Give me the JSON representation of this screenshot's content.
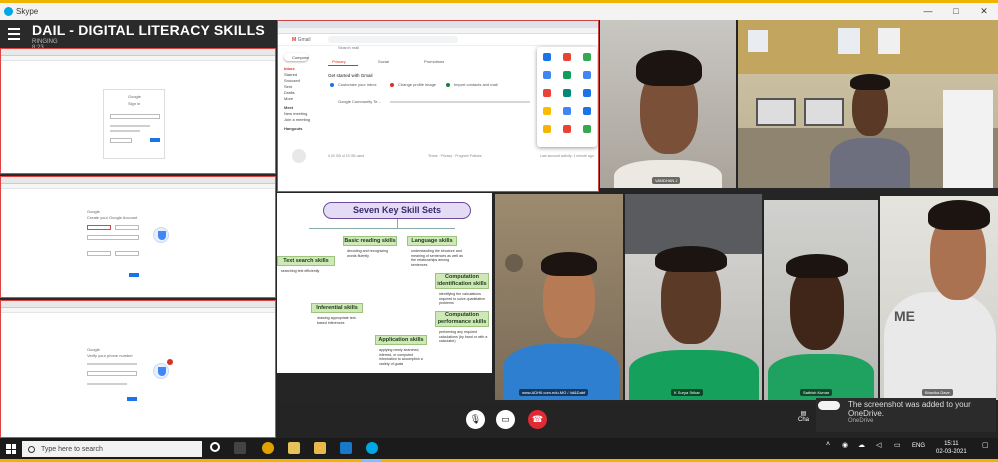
{
  "window": {
    "app_name": "Skype",
    "controls": [
      "—",
      "□",
      "✕"
    ]
  },
  "meeting": {
    "title": "DAIL - DIGITAL LITERACY SKILLS",
    "status": "RINGING",
    "timer": "8:23"
  },
  "left_panes": {
    "pane1": {
      "brand": "Google",
      "heading": "Sign in",
      "field": "Email or phone"
    },
    "pane2": {
      "brand": "Google",
      "heading": "Create your Google Account"
    },
    "pane3": {
      "brand": "Google",
      "heading": "Verify your phone number"
    }
  },
  "gmail": {
    "logo_text": "Gmail",
    "search_placeholder": "Search mail",
    "compose": "Compose",
    "nav": [
      "Inbox",
      "Starred",
      "Snoozed",
      "Sent",
      "Drafts",
      "More"
    ],
    "meet_label": "Meet",
    "meet_items": [
      "New meeting",
      "Join a meeting"
    ],
    "hangouts_label": "Hangouts",
    "tabs": [
      "Primary",
      "Social",
      "Promotions"
    ],
    "setup_title": "Get started with Gmail",
    "setup_items": [
      "Customize your inbox",
      "Change profile image",
      "Import contacts and mail"
    ],
    "notice": "Google Community Te...",
    "footer_left": "0.00 GB of 15 GB used",
    "footer_mid": "Terms · Privacy · Program Policies",
    "footer_right": "Last account activity: 1 minute ago"
  },
  "skills": {
    "title": "Seven Key Skill Sets",
    "items": [
      {
        "name": "Basic reading skills",
        "desc": "decoding and recognizing words fluently"
      },
      {
        "name": "Language skills",
        "desc": "understanding the structure and meaning of sentences as well as the relationships among sentences"
      },
      {
        "name": "Text search skills",
        "desc": "searching text efficiently"
      },
      {
        "name": "Computation identification skills",
        "desc": "identifying the calculations required to solve quantitative problems"
      },
      {
        "name": "Inferential skills",
        "desc": "drawing appropriate text-based inferences"
      },
      {
        "name": "Computation performance skills",
        "desc": "performing any required calculations (by hand or with a calculator)"
      },
      {
        "name": "Application skills",
        "desc": "applying newly searched, inferred, or computed information to accomplish a variety of goals"
      }
    ]
  },
  "participants": [
    {
      "label": "VANDHAN J"
    },
    {
      "label": ""
    },
    {
      "label": "www.ADHII.com.edu.MG / 4d&Dabf"
    },
    {
      "label": "K Surya Srikar"
    },
    {
      "label": "Sathish Kumar"
    },
    {
      "label": "Bhavika Dave"
    }
  ],
  "controls": {
    "mic": "microphone",
    "video": "camera",
    "hangup": "end-call",
    "chat_label": "Cha"
  },
  "toast": {
    "message": "The screenshot was added to your OneDrive.",
    "source": "OneDrive"
  },
  "taskbar": {
    "search_placeholder": "Type here to search",
    "lang": "ENG",
    "time": "15:11",
    "date": "02-03-2021"
  }
}
